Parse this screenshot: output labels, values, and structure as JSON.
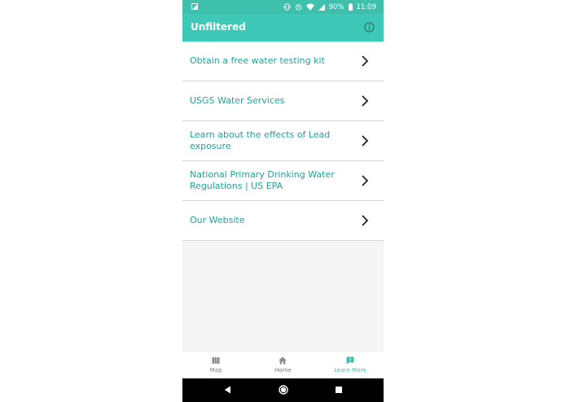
{
  "status_bar": {
    "battery": "90%",
    "time": "11:09"
  },
  "app_bar": {
    "title": "Unfiltered",
    "info_icon": "info-icon"
  },
  "links": [
    {
      "label": "Obtain a free water testing kit"
    },
    {
      "label": "USGS Water Services"
    },
    {
      "label": "Learn about the effects of Lead exposure"
    },
    {
      "label": "National Primary Drinking Water Regulations | US EPA"
    },
    {
      "label": "Our Website"
    }
  ],
  "bottom_nav": {
    "items": [
      {
        "label": "Map",
        "icon": "map-icon"
      },
      {
        "label": "Home",
        "icon": "home-icon"
      },
      {
        "label": "Learn More",
        "icon": "feedback-icon",
        "active": true
      }
    ]
  },
  "colors": {
    "accent": "#3ec8b7",
    "link_text": "#1fa396",
    "inactive_nav": "#7a7a7a"
  }
}
